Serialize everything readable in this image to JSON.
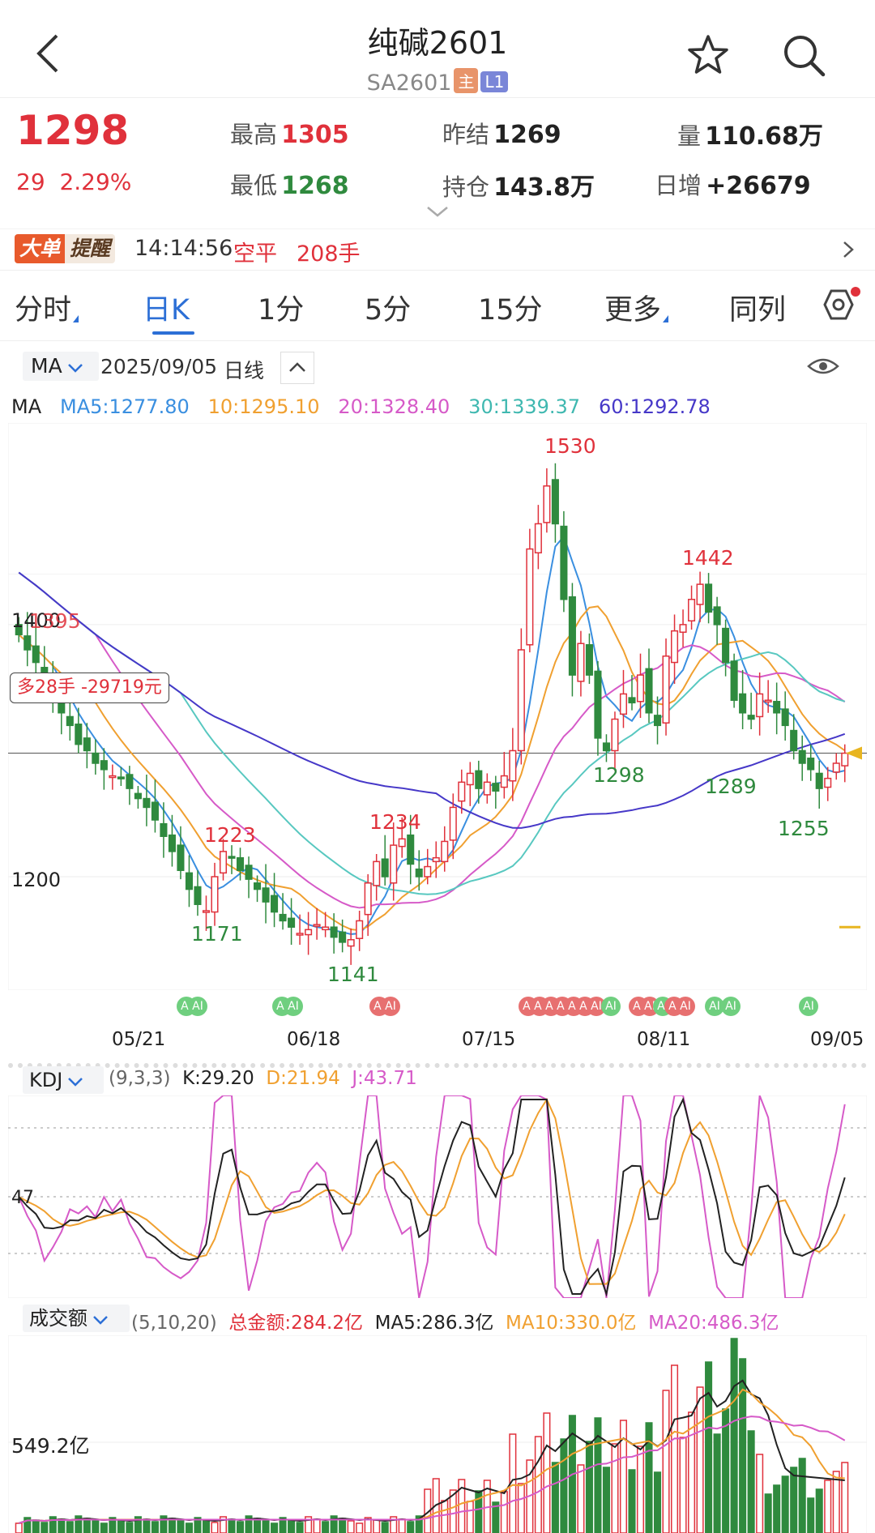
{
  "header": {
    "title": "纯碱2601",
    "code": "SA2601",
    "tag_main": "主",
    "tag_l1": "L1"
  },
  "quote": {
    "price": "1298",
    "change": "29",
    "change_pct": "2.29%",
    "high_label": "最高",
    "high": "1305",
    "low_label": "最低",
    "low": "1268",
    "prev_label": "昨结",
    "prev": "1269",
    "oi_label": "持仓",
    "oi": "143.8万",
    "vol_label": "量",
    "vol": "110.68万",
    "daily_label": "日增",
    "daily": "+26679"
  },
  "alert": {
    "badge1": "大单",
    "badge2": "提醒",
    "time": "14:14:56",
    "type": "空平",
    "qty": "208手"
  },
  "tabs": [
    "分时",
    "日K",
    "1分",
    "5分",
    "15分",
    "更多",
    "同列"
  ],
  "active_tab": "日K",
  "ma_bar": {
    "selector": "MA",
    "date": "2025/09/05",
    "period": "日线"
  },
  "ma_legend": {
    "label": "MA",
    "ma5": "MA5:1277.80",
    "ma10": "10:1295.10",
    "ma20": "20:1328.40",
    "ma30": "30:1339.37",
    "ma60": "60:1292.78"
  },
  "colors": {
    "up": "#e0313b",
    "down": "#2f8a3e",
    "ma5": "#3a8fe0",
    "ma10": "#f0a030",
    "ma20": "#d65ac8",
    "ma30": "#58c8c0",
    "ma60": "#4638c8",
    "accent": "#2c6fd6"
  },
  "main_chart": {
    "y_labels": [
      "1400",
      "1200"
    ],
    "position_label": "多28手 -29719元",
    "annotations": [
      {
        "text": "1530",
        "kind": "high"
      },
      {
        "text": "1442",
        "kind": "high"
      },
      {
        "text": "1395",
        "kind": "high"
      },
      {
        "text": "1234",
        "kind": "high"
      },
      {
        "text": "1223",
        "kind": "high"
      },
      {
        "text": "1298",
        "kind": "low"
      },
      {
        "text": "1289",
        "kind": "low"
      },
      {
        "text": "1255",
        "kind": "low"
      },
      {
        "text": "1171",
        "kind": "low"
      },
      {
        "text": "1141",
        "kind": "low"
      }
    ],
    "ai_badge": "AI",
    "x_labels": [
      "05/21",
      "06/18",
      "07/15",
      "08/11",
      "09/05"
    ]
  },
  "chart_data": {
    "type": "candlestick",
    "price_range": [
      1110,
      1560
    ],
    "closes": [
      1392,
      1380,
      1370,
      1355,
      1340,
      1330,
      1320,
      1305,
      1300,
      1290,
      1285,
      1280,
      1278,
      1270,
      1262,
      1255,
      1245,
      1232,
      1220,
      1205,
      1190,
      1178,
      1173,
      1200,
      1220,
      1215,
      1205,
      1198,
      1190,
      1180,
      1172,
      1165,
      1160,
      1155,
      1158,
      1162,
      1160,
      1152,
      1148,
      1150,
      1165,
      1195,
      1212,
      1200,
      1225,
      1230,
      1210,
      1200,
      1208,
      1215,
      1228,
      1255,
      1275,
      1282,
      1270,
      1275,
      1268,
      1280,
      1300,
      1380,
      1460,
      1480,
      1510,
      1480,
      1420,
      1360,
      1385,
      1360,
      1310,
      1300,
      1325,
      1345,
      1338,
      1360,
      1330,
      1320,
      1375,
      1395,
      1400,
      1420,
      1432,
      1410,
      1400,
      1370,
      1340,
      1330,
      1325,
      1345,
      1340,
      1330,
      1320,
      1300,
      1290,
      1285,
      1270,
      1278,
      1290,
      1298
    ],
    "kdj": {
      "params": "(9,3,3)",
      "K": "K:29.20",
      "D": "D:21.94",
      "J": "J:43.71",
      "y_label": "47"
    },
    "turnover": {
      "label": "成交额",
      "params": "(5,10,20)",
      "total": "总金额:284.2亿",
      "ma5": "MA5:286.3亿",
      "ma10": "MA10:330.0亿",
      "ma20": "MA20:486.3亿",
      "y_label": "549.2亿"
    }
  }
}
